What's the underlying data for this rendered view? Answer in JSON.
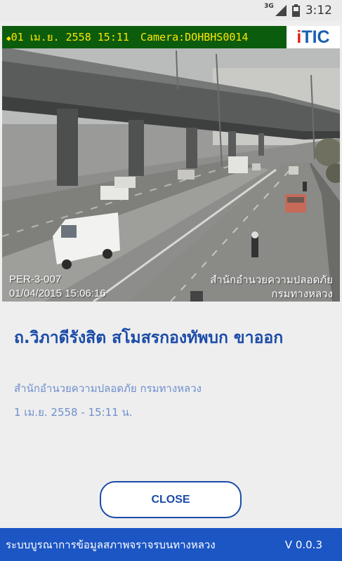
{
  "status_bar": {
    "network_type": "3G",
    "time": "3:12",
    "icons": [
      "signal-icon",
      "battery-icon"
    ]
  },
  "camera": {
    "overlay_datetime": "01 เม.ย. 2558 15:11",
    "overlay_camera": "Camera:DOHBHS0014",
    "logo_i": "i",
    "logo_rest": "TIC",
    "cam_id": "PER-3-007",
    "cam_timestamp": "01/04/2015 15:06:16",
    "agency_line1": "สำนักอำนวยความปลอดภัย",
    "agency_line2": "กรมทางหลวง"
  },
  "info": {
    "title": "ถ.วิภาดีรังสิต สโมสรกองทัพบก  ขาออก",
    "subtitle": "สำนักอำนวยความปลอดภัย กรมทางหลวง",
    "datetime": "1 เม.ย. 2558 - 15:11 น."
  },
  "actions": {
    "close_label": "CLOSE"
  },
  "footer": {
    "app_name": "ระบบบูรณาการข้อมูลสภาพจราจรบนทางหลวง",
    "version": "V 0.0.3"
  },
  "colors": {
    "accent": "#1a4ba8",
    "footer_bg": "#1c56c4",
    "muted_text": "#6f8fce",
    "overlay_bg": "#0c5c0d",
    "overlay_text": "#ffe600"
  }
}
